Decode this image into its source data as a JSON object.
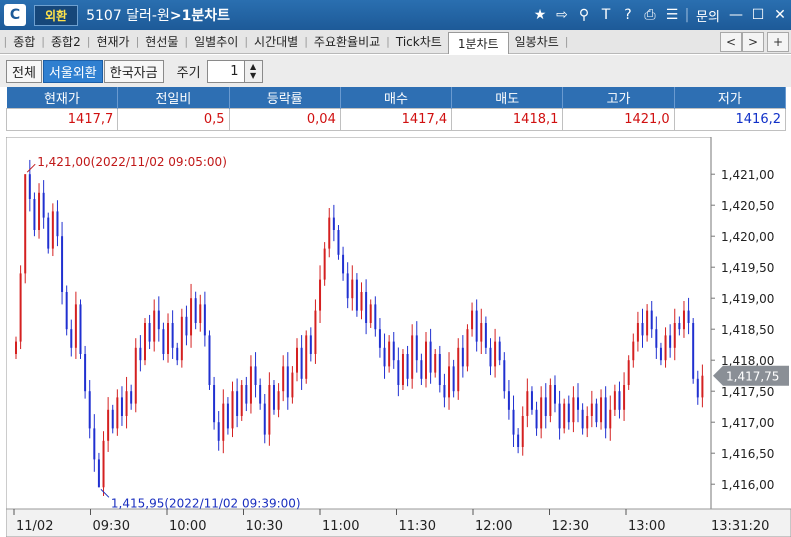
{
  "titlebar": {
    "badge": "외환",
    "code": "5107 달러-원",
    "screen": "1분차트",
    "tools": {
      "favorite": "★",
      "link": "⇨",
      "tools2": "⚲",
      "text": "T",
      "help": "?",
      "print": "⎙",
      "list": "☰",
      "inquiry": "문의",
      "minimize": "—",
      "maximize": "☐",
      "close": "✕"
    }
  },
  "tabs": [
    {
      "label": "종합",
      "active": false
    },
    {
      "label": "종합2",
      "active": false
    },
    {
      "label": "현재가",
      "active": false
    },
    {
      "label": "현선물",
      "active": false
    },
    {
      "label": "일별추이",
      "active": false
    },
    {
      "label": "시간대별",
      "active": false
    },
    {
      "label": "주요환율비교",
      "active": false
    },
    {
      "label": "Tick차트",
      "active": false
    },
    {
      "label": "1분차트",
      "active": true
    },
    {
      "label": "일봉차트",
      "active": false
    }
  ],
  "tabnav": {
    "prev": "<",
    "next": ">",
    "add": "+"
  },
  "toolbar": {
    "segments": [
      {
        "label": "전체",
        "active": false
      },
      {
        "label": "서울외환",
        "active": true
      },
      {
        "label": "한국자금",
        "active": false
      }
    ],
    "period_label": "주기",
    "period_value": "1"
  },
  "quote": {
    "headers": [
      "현재가",
      "전일비",
      "등락률",
      "매수",
      "매도",
      "고가",
      "저가"
    ],
    "values": [
      "1417,7",
      "0,5",
      "0,04",
      "1417,4",
      "1418,1",
      "1421,0",
      "1416,2"
    ],
    "tones": [
      "up",
      "up",
      "up",
      "up",
      "up",
      "up",
      "down"
    ]
  },
  "chart_data": {
    "type": "candlestick",
    "ylim": [
      1415.6,
      1421.6
    ],
    "y_ticks": [
      1416.0,
      1416.5,
      1417.0,
      1417.5,
      1418.0,
      1418.5,
      1419.0,
      1419.5,
      1420.0,
      1420.5,
      1421.0
    ],
    "y_tick_labels": [
      "1,416,00",
      "1,416,50",
      "1,417,00",
      "1,417,50",
      "1,418,00",
      "1,418,50",
      "1,419,00",
      "1,419,50",
      "1,420,00",
      "1,420,50",
      "1,421,00"
    ],
    "x_labels": [
      "11/02",
      "09:30",
      "10:00",
      "10:30",
      "11:00",
      "11:30",
      "12:00",
      "12:30",
      "13:00",
      "13:31:20"
    ],
    "current_price": 1417.75,
    "current_label": "1,417,75",
    "high_annotation": "1,421,00(2022/11/02 09:05:00)",
    "low_annotation": "1,415,95(2022/11/02 09:39:00)",
    "high": 1421.0,
    "low": 1415.95,
    "colors": {
      "up": "#d42020",
      "down": "#2030d0"
    },
    "close_path": [
      1418.3,
      1419.4,
      1421.0,
      1420.6,
      1420.1,
      1420.7,
      1420.3,
      1419.8,
      1420.4,
      1420.0,
      1419.1,
      1418.5,
      1418.2,
      1418.9,
      1418.1,
      1417.5,
      1416.9,
      1416.4,
      1415.95,
      1416.7,
      1417.2,
      1416.9,
      1417.4,
      1417.1,
      1417.5,
      1417.3,
      1418.2,
      1418.0,
      1418.6,
      1418.3,
      1418.8,
      1418.5,
      1418.1,
      1418.6,
      1418.2,
      1418.0,
      1418.7,
      1418.4,
      1419.0,
      1418.6,
      1418.9,
      1418.4,
      1417.6,
      1417.0,
      1416.7,
      1417.3,
      1416.9,
      1417.5,
      1417.1,
      1417.6,
      1417.3,
      1417.9,
      1417.6,
      1417.3,
      1416.8,
      1417.6,
      1417.2,
      1417.5,
      1417.9,
      1417.4,
      1417.8,
      1418.2,
      1417.7,
      1418.4,
      1418.1,
      1418.8,
      1419.3,
      1419.8,
      1420.3,
      1420.1,
      1419.7,
      1419.4,
      1419.0,
      1419.3,
      1418.8,
      1419.1,
      1418.6,
      1418.9,
      1418.5,
      1418.2,
      1417.9,
      1418.3,
      1418.0,
      1417.6,
      1418.1,
      1417.7,
      1418.4,
      1418.0,
      1417.7,
      1418.3,
      1417.8,
      1418.1,
      1417.6,
      1417.4,
      1417.9,
      1417.5,
      1418.2,
      1417.9,
      1418.5,
      1418.8,
      1418.3,
      1418.6,
      1418.2,
      1417.9,
      1418.3,
      1418.0,
      1417.5,
      1417.2,
      1416.8,
      1416.6,
      1417.1,
      1417.5,
      1417.2,
      1416.9,
      1417.4,
      1417.1,
      1417.6,
      1417.3,
      1416.9,
      1417.3,
      1417.0,
      1417.4,
      1417.2,
      1416.9,
      1417.1,
      1417.3,
      1417.0,
      1417.4,
      1416.9,
      1417.2,
      1417.5,
      1417.2,
      1417.6,
      1418.0,
      1418.3,
      1418.6,
      1418.4,
      1418.8,
      1418.5,
      1418.2,
      1418.0,
      1418.4,
      1418.2,
      1418.6,
      1418.5,
      1418.8,
      1418.6,
      1417.7,
      1417.4,
      1417.75
    ]
  }
}
